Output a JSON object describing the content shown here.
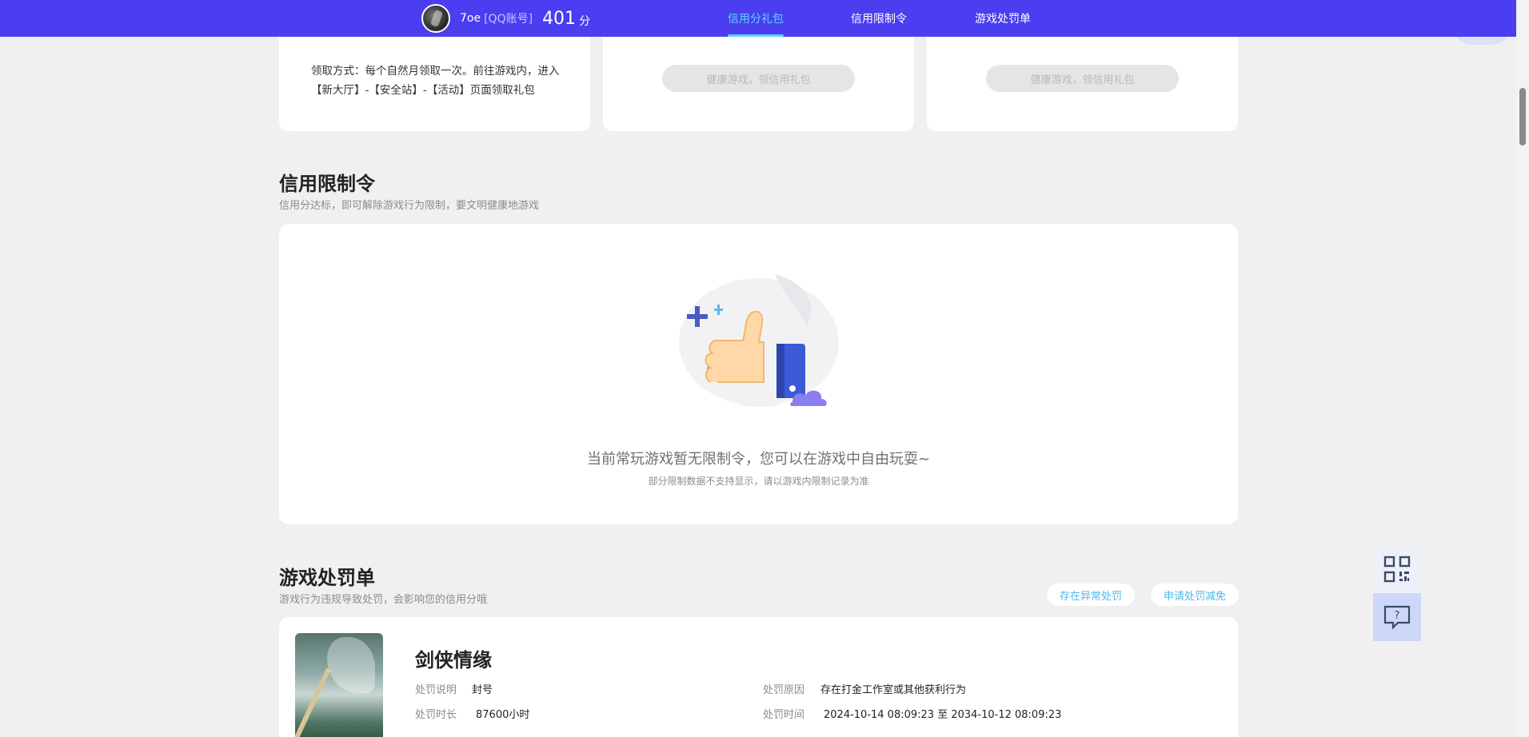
{
  "header": {
    "username": "7oe",
    "account_type": "[QQ账号]",
    "score": "401",
    "score_unit": "分",
    "tabs": [
      {
        "label": "信用分礼包",
        "active": true
      },
      {
        "label": "信用限制令",
        "active": false
      },
      {
        "label": "游戏处罚单",
        "active": false
      }
    ]
  },
  "gift_cards": {
    "claim_text": "领取方式：每个自然月领取一次。前往游戏内，进入【新大厅】-【安全站】-【活动】页面领取礼包",
    "disabled_button_label": "健康游戏，领信用礼包"
  },
  "restriction": {
    "title": "信用限制令",
    "subtitle": "信用分达标，即可解除游戏行为限制，要文明健康地游戏",
    "empty_main": "当前常玩游戏暂无限制令，您可以在游戏中自由玩耍~",
    "empty_sub": "部分限制数据不支持显示，请以游戏内限制记录为准"
  },
  "penalty": {
    "title": "游戏处罚单",
    "subtitle": "游戏行为违规导致处罚，会影响您的信用分哦",
    "buttons": {
      "appeal": "存在异常处罚",
      "reduce": "申请处罚减免"
    },
    "item": {
      "game_name": "剑侠情缘",
      "desc_label": "处罚说明",
      "desc_value": "封号",
      "reason_label": "处罚原因",
      "reason_value": "存在打金工作室或其他获利行为",
      "duration_label": "处罚时长",
      "duration_value": "87600小时",
      "time_label": "处罚时间",
      "time_value": "2024-10-14 08:09:23 至 2034-10-12 08:09:23"
    }
  },
  "colors": {
    "nav_bg": "#4b3df0",
    "accent": "#5fd3ff",
    "link": "#4fb8e8"
  },
  "icons": {
    "float_top": "qr-code-icon",
    "float_bottom": "feedback-icon"
  }
}
